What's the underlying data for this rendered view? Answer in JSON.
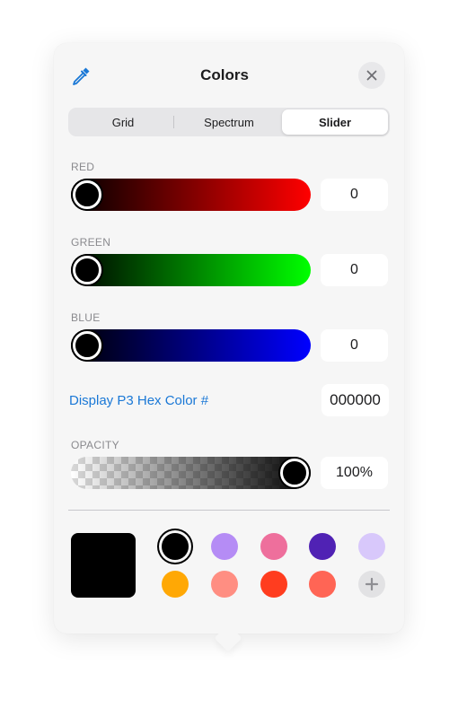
{
  "header": {
    "title": "Colors",
    "eyedropper_icon": "eyedropper-icon",
    "close_icon": "close-icon"
  },
  "tabs": [
    {
      "label": "Grid",
      "active": false
    },
    {
      "label": "Spectrum",
      "active": false
    },
    {
      "label": "Slider",
      "active": true
    }
  ],
  "sliders": {
    "red": {
      "label": "RED",
      "value": "0"
    },
    "green": {
      "label": "GREEN",
      "value": "0"
    },
    "blue": {
      "label": "BLUE",
      "value": "0"
    },
    "opacity": {
      "label": "OPACITY",
      "value": "100%"
    }
  },
  "hex": {
    "link_label": "Display P3 Hex Color #",
    "value": "000000"
  },
  "current_color": "#000000",
  "swatches": [
    {
      "color": "#000000",
      "selected": true
    },
    {
      "color": "#b58cf5",
      "selected": false
    },
    {
      "color": "#ee6f9c",
      "selected": false
    },
    {
      "color": "#5022b4",
      "selected": false
    },
    {
      "color": "#d8c8fb",
      "selected": false
    },
    {
      "color": "#ffa805",
      "selected": false
    },
    {
      "color": "#ff8e82",
      "selected": false
    },
    {
      "color": "#ff3d1f",
      "selected": false
    },
    {
      "color": "#ff6555",
      "selected": false
    }
  ],
  "add_icon": "plus-icon",
  "colors": {
    "accent": "#1a78d6",
    "panel": "#f6f6f6"
  }
}
